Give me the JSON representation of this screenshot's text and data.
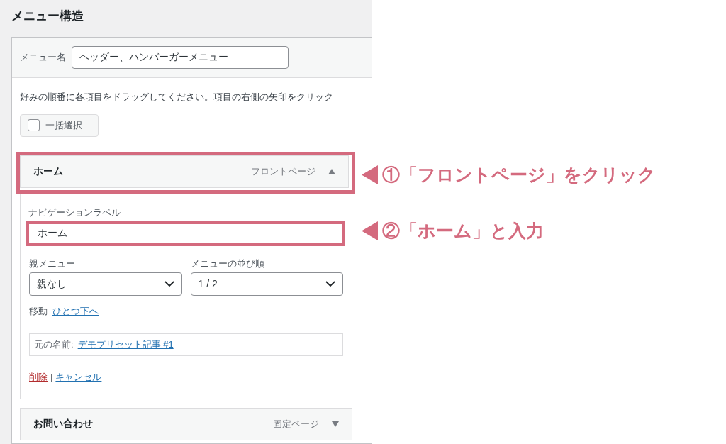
{
  "title": "メニュー構造",
  "menu_name": {
    "label": "メニュー名",
    "value": "ヘッダー、ハンバーガーメニュー"
  },
  "instructions": "好みの順番に各項目をドラッグしてください。項目の右側の矢印をクリック",
  "bulk_select": {
    "label": "一括選択",
    "checked": false
  },
  "items": [
    {
      "title": "ホーム",
      "type_label": "フロントページ",
      "expanded": true,
      "highlighted": true,
      "settings": {
        "nav_label": {
          "label": "ナビゲーションラベル",
          "value": "ホーム",
          "highlighted": true
        },
        "parent": {
          "label": "親メニュー",
          "value": "親なし"
        },
        "order": {
          "label": "メニューの並び順",
          "value": "1 / 2"
        },
        "move": {
          "label": "移動",
          "link": "ひとつ下へ"
        },
        "original": {
          "label": "元の名前:",
          "link": "デモプリセット記事 #1"
        },
        "delete": "削除",
        "separator": "|",
        "cancel": "キャンセル"
      }
    },
    {
      "title": "お問い合わせ",
      "type_label": "固定ページ",
      "expanded": false,
      "highlighted": false
    }
  ],
  "annotations": [
    {
      "text": "①「フロントページ」をクリック"
    },
    {
      "text": "②「ホーム」と入力"
    }
  ]
}
